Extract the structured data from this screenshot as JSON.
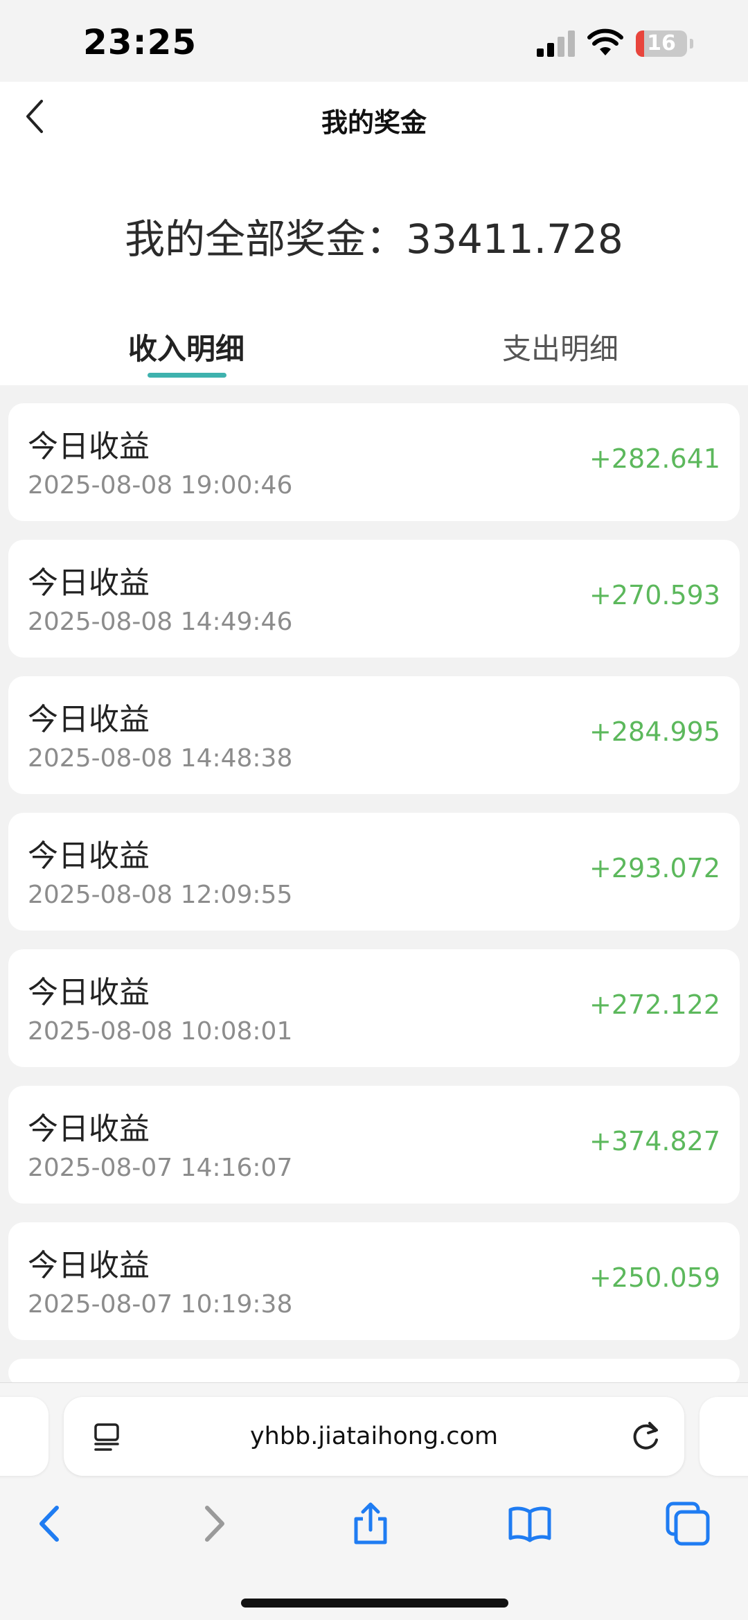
{
  "status_bar": {
    "time": "23:25",
    "battery": "16",
    "battery_level": 0.16
  },
  "header": {
    "title": "我的奖金",
    "total": "我的全部奖金：33411.728",
    "tabs": [
      {
        "label": "收入明细",
        "active": true
      },
      {
        "label": "支出明细",
        "active": false
      }
    ]
  },
  "records": [
    {
      "title": "今日收益",
      "time": "2025-08-08 19:00:46",
      "amount": "+282.641"
    },
    {
      "title": "今日收益",
      "time": "2025-08-08 14:49:46",
      "amount": "+270.593"
    },
    {
      "title": "今日收益",
      "time": "2025-08-08 14:48:38",
      "amount": "+284.995"
    },
    {
      "title": "今日收益",
      "time": "2025-08-08 12:09:55",
      "amount": "+293.072"
    },
    {
      "title": "今日收益",
      "time": "2025-08-08 10:08:01",
      "amount": "+272.122"
    },
    {
      "title": "今日收益",
      "time": "2025-08-07 14:16:07",
      "amount": "+374.827"
    },
    {
      "title": "今日收益",
      "time": "2025-08-07 10:19:38",
      "amount": "+250.059"
    }
  ],
  "browser": {
    "url": "yhbb.jiataihong.com"
  },
  "colors": {
    "accent": "#3fb2ae",
    "amount": "#5cb85c",
    "ios_blue": "#1f7cf2"
  },
  "icons": [
    "back-icon",
    "reader-icon",
    "reload-icon",
    "back-nav-icon",
    "forward-nav-icon",
    "share-icon",
    "bookmarks-icon",
    "tabs-icon"
  ]
}
